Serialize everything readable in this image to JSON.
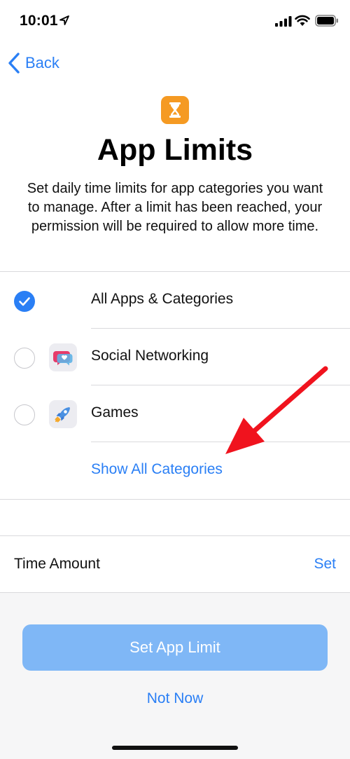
{
  "status_bar": {
    "time": "10:01"
  },
  "nav": {
    "back_label": "Back"
  },
  "header": {
    "title": "App Limits",
    "description": "Set daily time limits for app categories you want to manage. After a limit has been reached, your permission will be required to allow more time."
  },
  "categories": [
    {
      "label": "All Apps & Categories",
      "selected": true
    },
    {
      "label": "Social Networking",
      "selected": false,
      "icon": "social-networking-icon"
    },
    {
      "label": "Games",
      "selected": false,
      "icon": "games-rocket-icon"
    }
  ],
  "show_all_label": "Show All Categories",
  "time_amount": {
    "label": "Time Amount",
    "action": "Set"
  },
  "buttons": {
    "primary": "Set App Limit",
    "secondary": "Not Now"
  },
  "colors": {
    "accent": "#2a7ff5",
    "primary_disabled": "#7fb7f6",
    "app_icon": "#f59a23",
    "annotation": "#f0131e"
  }
}
